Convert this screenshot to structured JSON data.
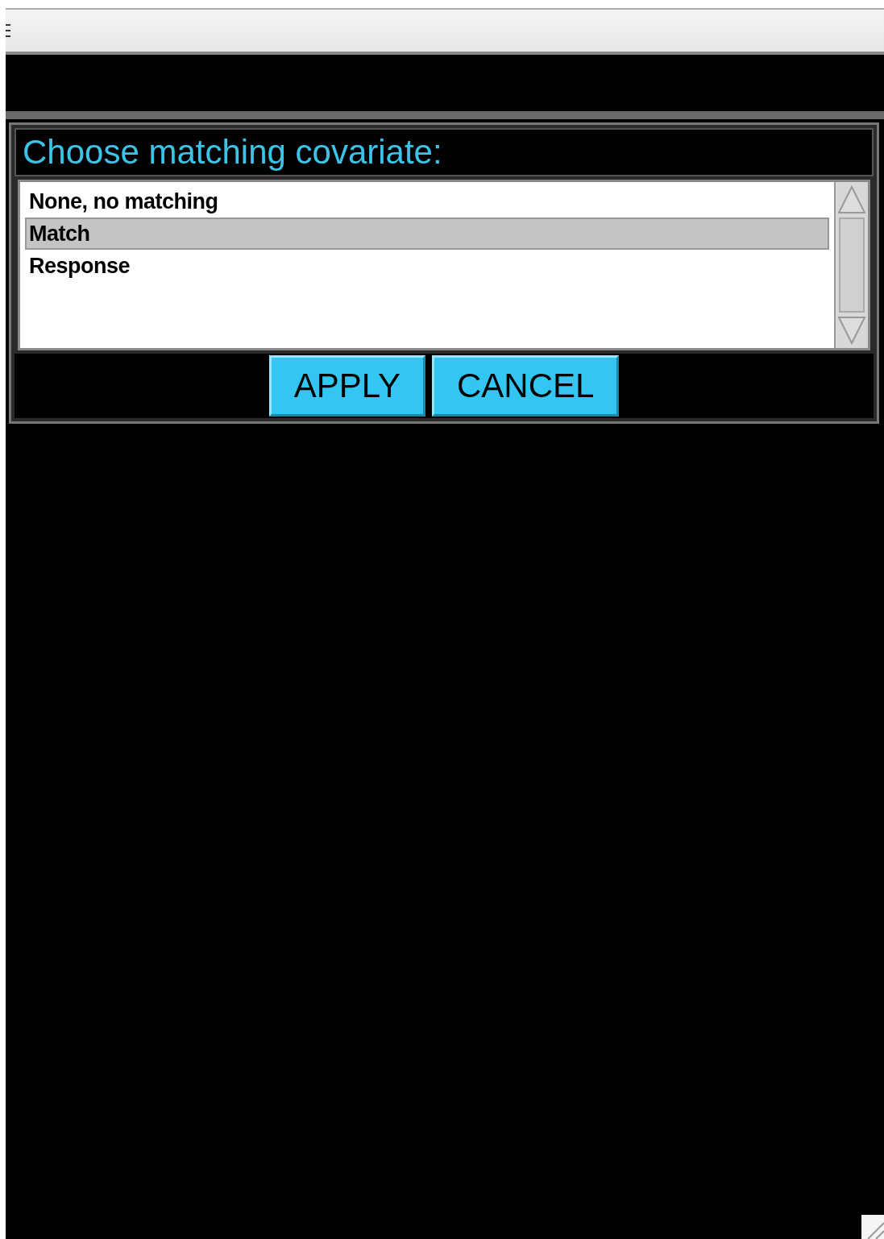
{
  "dialog": {
    "title": "Choose matching covariate:",
    "options": [
      {
        "label": "None, no matching",
        "selected": false
      },
      {
        "label": "Match",
        "selected": true
      },
      {
        "label": "Response",
        "selected": false
      }
    ],
    "buttons": [
      "APPLY",
      "CANCEL"
    ]
  }
}
